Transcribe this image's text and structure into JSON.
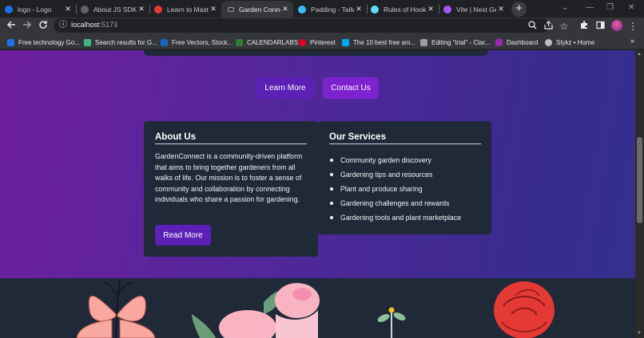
{
  "browser": {
    "tabs": [
      {
        "title": "logo - Logo",
        "color": "#1a73e8"
      },
      {
        "title": "About JS SDK |",
        "color": "#5f6368"
      },
      {
        "title": "Learn to Maste",
        "color": "#e53935"
      },
      {
        "title": "Garden Connec",
        "color": "#9aa0a6",
        "active": true
      },
      {
        "title": "Padding - Tailw",
        "color": "#38bdf8"
      },
      {
        "title": "Rules of Hooks",
        "color": "#61dafb"
      },
      {
        "title": "Vite | Next Gen",
        "color": "#a855f7"
      }
    ],
    "tab_close_glyph": "✕",
    "new_tab_glyph": "+",
    "url_host": "localhost",
    "url_port": ":5173",
    "bookmarks": [
      {
        "label": "Free technology Go...",
        "color": "#1a73e8"
      },
      {
        "label": "Search results for G...",
        "color": "#41b883"
      },
      {
        "label": "Free Vectors, Stock...",
        "color": "#1565c0"
      },
      {
        "label": "CALENDARLABS",
        "color": "#2e7d32"
      },
      {
        "label": "Pinterest",
        "color": "#e60023"
      },
      {
        "label": "The 10 best free ani...",
        "color": "#03a9f4"
      },
      {
        "label": "Editing \"trial\" - Clar...",
        "color": "#9e9e9e"
      },
      {
        "label": "Dashboard",
        "color": "#9c27b0"
      },
      {
        "label": "Stykz • Home",
        "color": "#bdbdbd"
      }
    ],
    "bookmarks_more": "»",
    "icons": {
      "back": "back-arrow-icon",
      "forward": "forward-arrow-icon",
      "reload": "reload-icon",
      "info": "site-info-icon",
      "zoom": "zoom-icon",
      "share": "share-icon",
      "star": "bookmark-star-icon",
      "extensions": "extensions-icon",
      "sidepanel": "side-panel-icon",
      "menu": "kebab-menu-icon"
    }
  },
  "page": {
    "hero_buttons": {
      "learn_more": "Learn More",
      "contact_us": "Contact Us"
    },
    "about": {
      "title": "About Us",
      "body": "GardenConnect is a community-driven platform that aims to bring together gardeners from all walks of life. Our mission is to foster a sense of community and collaboration by connecting individuals who share a passion for gardening.",
      "button": "Read More"
    },
    "services": {
      "title": "Our Services",
      "items": [
        "Community garden discovery",
        "Gardening tips and resources",
        "Plant and produce sharing",
        "Gardening challenges and rewards",
        "Gardening tools and plant marketplace"
      ]
    },
    "footer_illustrations": [
      "lily-flower-icon",
      "pink-rose-icon",
      "seedling-icon",
      "red-rose-icon"
    ],
    "colors": {
      "gradient_start": "#6e1f9e",
      "gradient_end": "#34308e",
      "card": "#1f2937",
      "button_primary": "#5b21b6",
      "button_contact": "#7e22ce"
    }
  }
}
